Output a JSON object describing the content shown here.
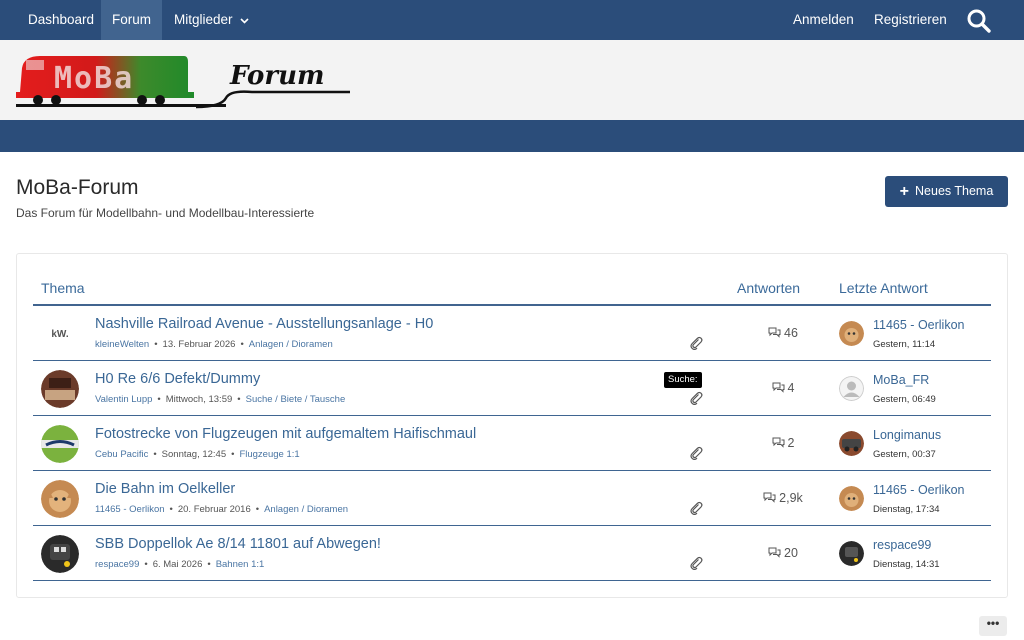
{
  "nav": {
    "dashboard": "Dashboard",
    "forum": "Forum",
    "members": "Mitglieder",
    "login": "Anmelden",
    "register": "Registrieren"
  },
  "logo": {
    "moba": "MoBa",
    "forum": "Forum"
  },
  "page": {
    "title": "MoBa-Forum",
    "subtitle": "Das Forum für Modellbahn- und Modellbau-Interessierte",
    "new_thread": "Neues Thema"
  },
  "columns": {
    "thema": "Thema",
    "antworten": "Antworten",
    "letzte": "Letzte Antwort"
  },
  "tooltip": "Suche:",
  "threads": [
    {
      "title": "Nashville Railroad Avenue - Ausstellungsanlage - H0",
      "author": "kleineWelten",
      "date": "13. Februar 2026",
      "category": "Anlagen / Dioramen",
      "replies": "46",
      "last_user": "11465 - Oerlikon",
      "last_date": "Gestern, 11:14",
      "avatar_text": "kW."
    },
    {
      "title": "H0 Re 6/6 Defekt/Dummy",
      "author": "Valentin Lupp",
      "date": "Mittwoch, 13:59",
      "category": "Suche / Biete / Tausche",
      "replies": "4",
      "last_user": "MoBa_FR",
      "last_date": "Gestern, 06:49"
    },
    {
      "title": "Fotostrecke von Flugzeugen mit aufgemaltem Haifischmaul",
      "author": "Cebu Pacific",
      "date": "Sonntag, 12:45",
      "category": "Flugzeuge 1:1",
      "replies": "2",
      "last_user": "Longimanus",
      "last_date": "Gestern, 00:37"
    },
    {
      "title": "Die Bahn im Oelkeller",
      "author": "11465 - Oerlikon",
      "date": "20. Februar 2016",
      "category": "Anlagen / Dioramen",
      "replies": "2,9k",
      "last_user": "11465 - Oerlikon",
      "last_date": "Dienstag, 17:34"
    },
    {
      "title": "SBB Doppellok Ae 8/14 11801 auf Abwegen!",
      "author": "respace99",
      "date": "6. Mai 2026",
      "category": "Bahnen 1:1",
      "replies": "20",
      "last_user": "respace99",
      "last_date": "Dienstag, 14:31"
    }
  ],
  "more_label": "•••"
}
